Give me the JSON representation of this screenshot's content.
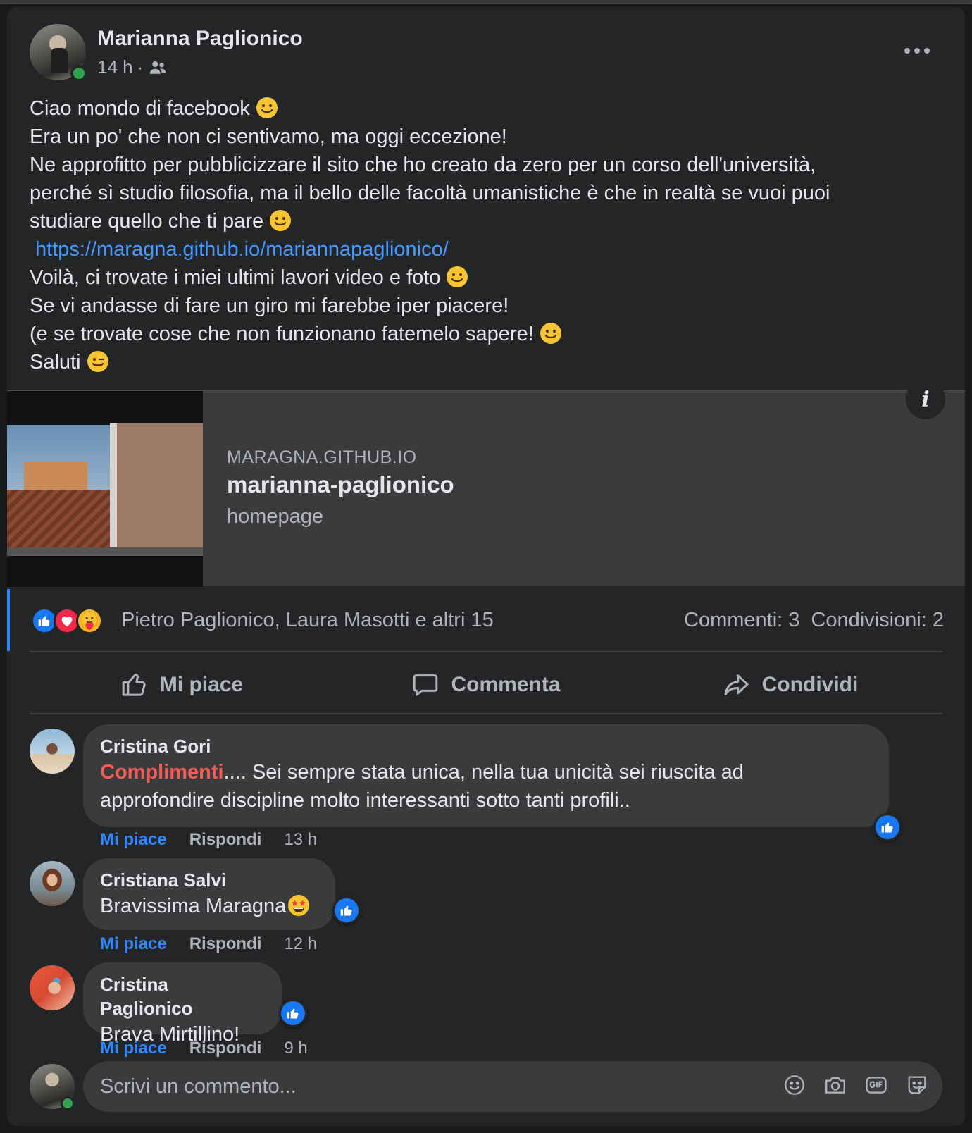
{
  "post": {
    "author": "Marianna Paglionico",
    "time": "14 h",
    "separator": "·",
    "audience_icon": "friends-icon",
    "lines": [
      "Ciao mondo di facebook",
      "Era un po' che non ci sentivamo, ma oggi eccezione!",
      "Ne approfitto per pubblicizzare il sito che ho creato da zero per un corso dell'università,",
      "perché sì studio filosofia, ma il bello delle facoltà umanistiche è che in realtà se vuoi puoi",
      "studiare quello che ti pare",
      "Voilà, ci trovate i miei ultimi lavori video e foto",
      "Se vi andasse di fare un giro mi farebbe iper piacere!",
      "(e se trovate cose che non funzionano fatemelo sapere!",
      "Saluti"
    ],
    "link": "https://maragna.github.io/mariannapaglionico/"
  },
  "preview": {
    "domain": "MARAGNA.GITHUB.IO",
    "title": "marianna-paglionico",
    "subtitle": "homepage",
    "info_label": "i"
  },
  "reactions": {
    "types": [
      "like",
      "love",
      "care"
    ],
    "names": "Pietro Paglionico, Laura Masotti e altri 15",
    "comments_count": "Commenti: 3",
    "shares_count": "Condivisioni: 2"
  },
  "actions": {
    "like": "Mi piace",
    "comment": "Commenta",
    "share": "Condividi"
  },
  "comments": [
    {
      "name": "Cristina Gori",
      "highlight": "Complimenti",
      "text_line1": ".... Sei sempre stata unica, nella tua unicità sei riuscita ad",
      "text_line2": "approfondire discipline molto interessanti sotto tanti profili..",
      "like": "Mi piace",
      "reply": "Rispondi",
      "time": "13 h"
    },
    {
      "name": "Cristiana Salvi",
      "text": "Bravissima Maragna",
      "like": "Mi piace",
      "reply": "Rispondi",
      "time": "12 h"
    },
    {
      "name": "Cristina Paglionico",
      "text": "Brava Mirtillino!",
      "like": "Mi piace",
      "reply": "Rispondi",
      "time": "9 h"
    }
  ],
  "composer": {
    "placeholder": "Scrivi un commento...",
    "icons": [
      "emoji-icon",
      "camera-icon",
      "gif-icon",
      "sticker-icon"
    ]
  },
  "colors": {
    "background": "#18191a",
    "card": "#242526",
    "bubble": "#3a3b3c",
    "accent": "#2d88ff",
    "link": "#4599ff",
    "online": "#31a24c",
    "highlight": "#f25c54"
  }
}
